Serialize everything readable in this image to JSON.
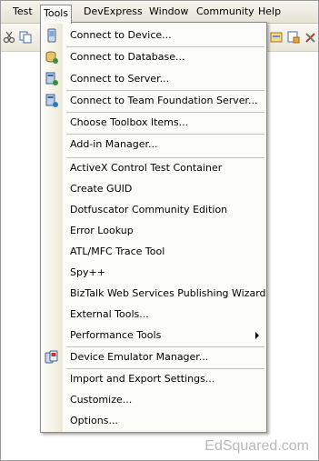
{
  "menubar": {
    "items": [
      {
        "label": "Test"
      },
      {
        "label": "Tools"
      },
      {
        "label": "DevExpress"
      },
      {
        "label": "Window"
      },
      {
        "label": "Community"
      },
      {
        "label": "Help"
      }
    ],
    "open_item": "Tools"
  },
  "tools_menu": {
    "items": [
      {
        "label": "Connect to Device...",
        "icon": "device-icon"
      },
      {
        "label": "Connect to Database...",
        "icon": "database-icon"
      },
      {
        "label": "Connect to Server...",
        "icon": "server-icon"
      },
      {
        "label": "Connect to Team Foundation Server...",
        "icon": "team-server-icon"
      },
      {
        "label": "Choose Toolbox Items..."
      },
      {
        "label": "Add-in Manager..."
      },
      {
        "label": "ActiveX Control Test Container"
      },
      {
        "label": "Create GUID"
      },
      {
        "label": "Dotfuscator Community Edition"
      },
      {
        "label": "Error Lookup"
      },
      {
        "label": "ATL/MFC Trace Tool"
      },
      {
        "label": "Spy++"
      },
      {
        "label": "BizTalk Web Services Publishing Wizard"
      },
      {
        "label": "External Tools..."
      },
      {
        "label": "Performance Tools",
        "has_submenu": true
      },
      {
        "label": "Device Emulator Manager...",
        "icon": "emulator-icon"
      },
      {
        "label": "Import and Export Settings..."
      },
      {
        "label": "Customize..."
      },
      {
        "label": "Options..."
      }
    ]
  },
  "watermark": "EdSquared.com",
  "colors": {
    "menu_bg": "#fcfcf9",
    "gutter_bg": "#ece9d8",
    "separator": "#c5c2b2",
    "menubar_bg": "#e6e3d6"
  }
}
